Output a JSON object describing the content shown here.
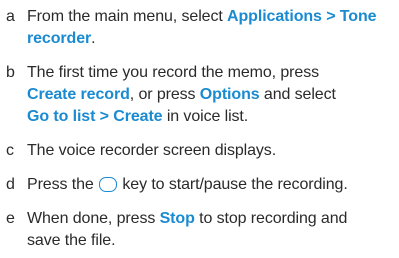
{
  "steps": [
    {
      "letter": "a",
      "t1": "From the main menu, select ",
      "k1": "Applications > Tone",
      "k2": "recorder",
      "t2": "."
    },
    {
      "letter": "b",
      "t1": "The first time you record the memo, press",
      "k1": "Create record",
      "t2": ", or press ",
      "k2": "Options",
      "t3": " and select",
      "k3": "Go to list > Create",
      "t4": " in voice list."
    },
    {
      "letter": "c",
      "t1": "The voice recorder screen displays."
    },
    {
      "letter": "d",
      "t1": "Press the ",
      "key_icon": "round-key-icon",
      "t2": " key to start/pause the recording."
    },
    {
      "letter": "e",
      "t1": "When done, press ",
      "k1": "Stop",
      "t2": " to stop recording and",
      "t3": "save the file."
    }
  ],
  "colors": {
    "keyword": "#1a8bd0",
    "body_text": "#2a2a2a"
  }
}
